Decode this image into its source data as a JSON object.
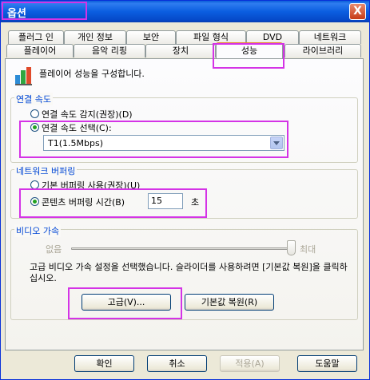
{
  "window": {
    "title": "옵션",
    "close": "X"
  },
  "tabs_row1": [
    "플러그 인",
    "개인 정보",
    "보안",
    "파일 형식",
    "DVD",
    "네트워크"
  ],
  "tabs_row2": [
    "플레이어",
    "음악 리핑",
    "장치",
    "성능",
    "라이브러리"
  ],
  "header": {
    "text": "플레이어 성능을 구성합니다."
  },
  "connection": {
    "label": "연결 속도",
    "detect": "연결 속도 감지(권장)(D)",
    "choose": "연결 속도 선택(C):",
    "speed_value": "T1(1.5Mbps)"
  },
  "buffering": {
    "label": "네트워크 버퍼링",
    "default": "기본 버퍼링 사용(권장)(U)",
    "custom": "콘텐츠 버퍼링 시간(B)",
    "seconds_value": "15",
    "unit": "초"
  },
  "video": {
    "label": "비디오 가속",
    "none_label": "없음",
    "full_label": "최대",
    "info": "고급 비디오 가속 설정을 선택했습니다. 슬라이더를 사용하려면 [기본값 복원]을 클릭하십시오.",
    "advanced_btn": "고급(V)...",
    "restore_btn": "기본값 복원(R)"
  },
  "footer": {
    "ok": "확인",
    "cancel": "취소",
    "apply": "적용(A)",
    "help": "도움말"
  }
}
